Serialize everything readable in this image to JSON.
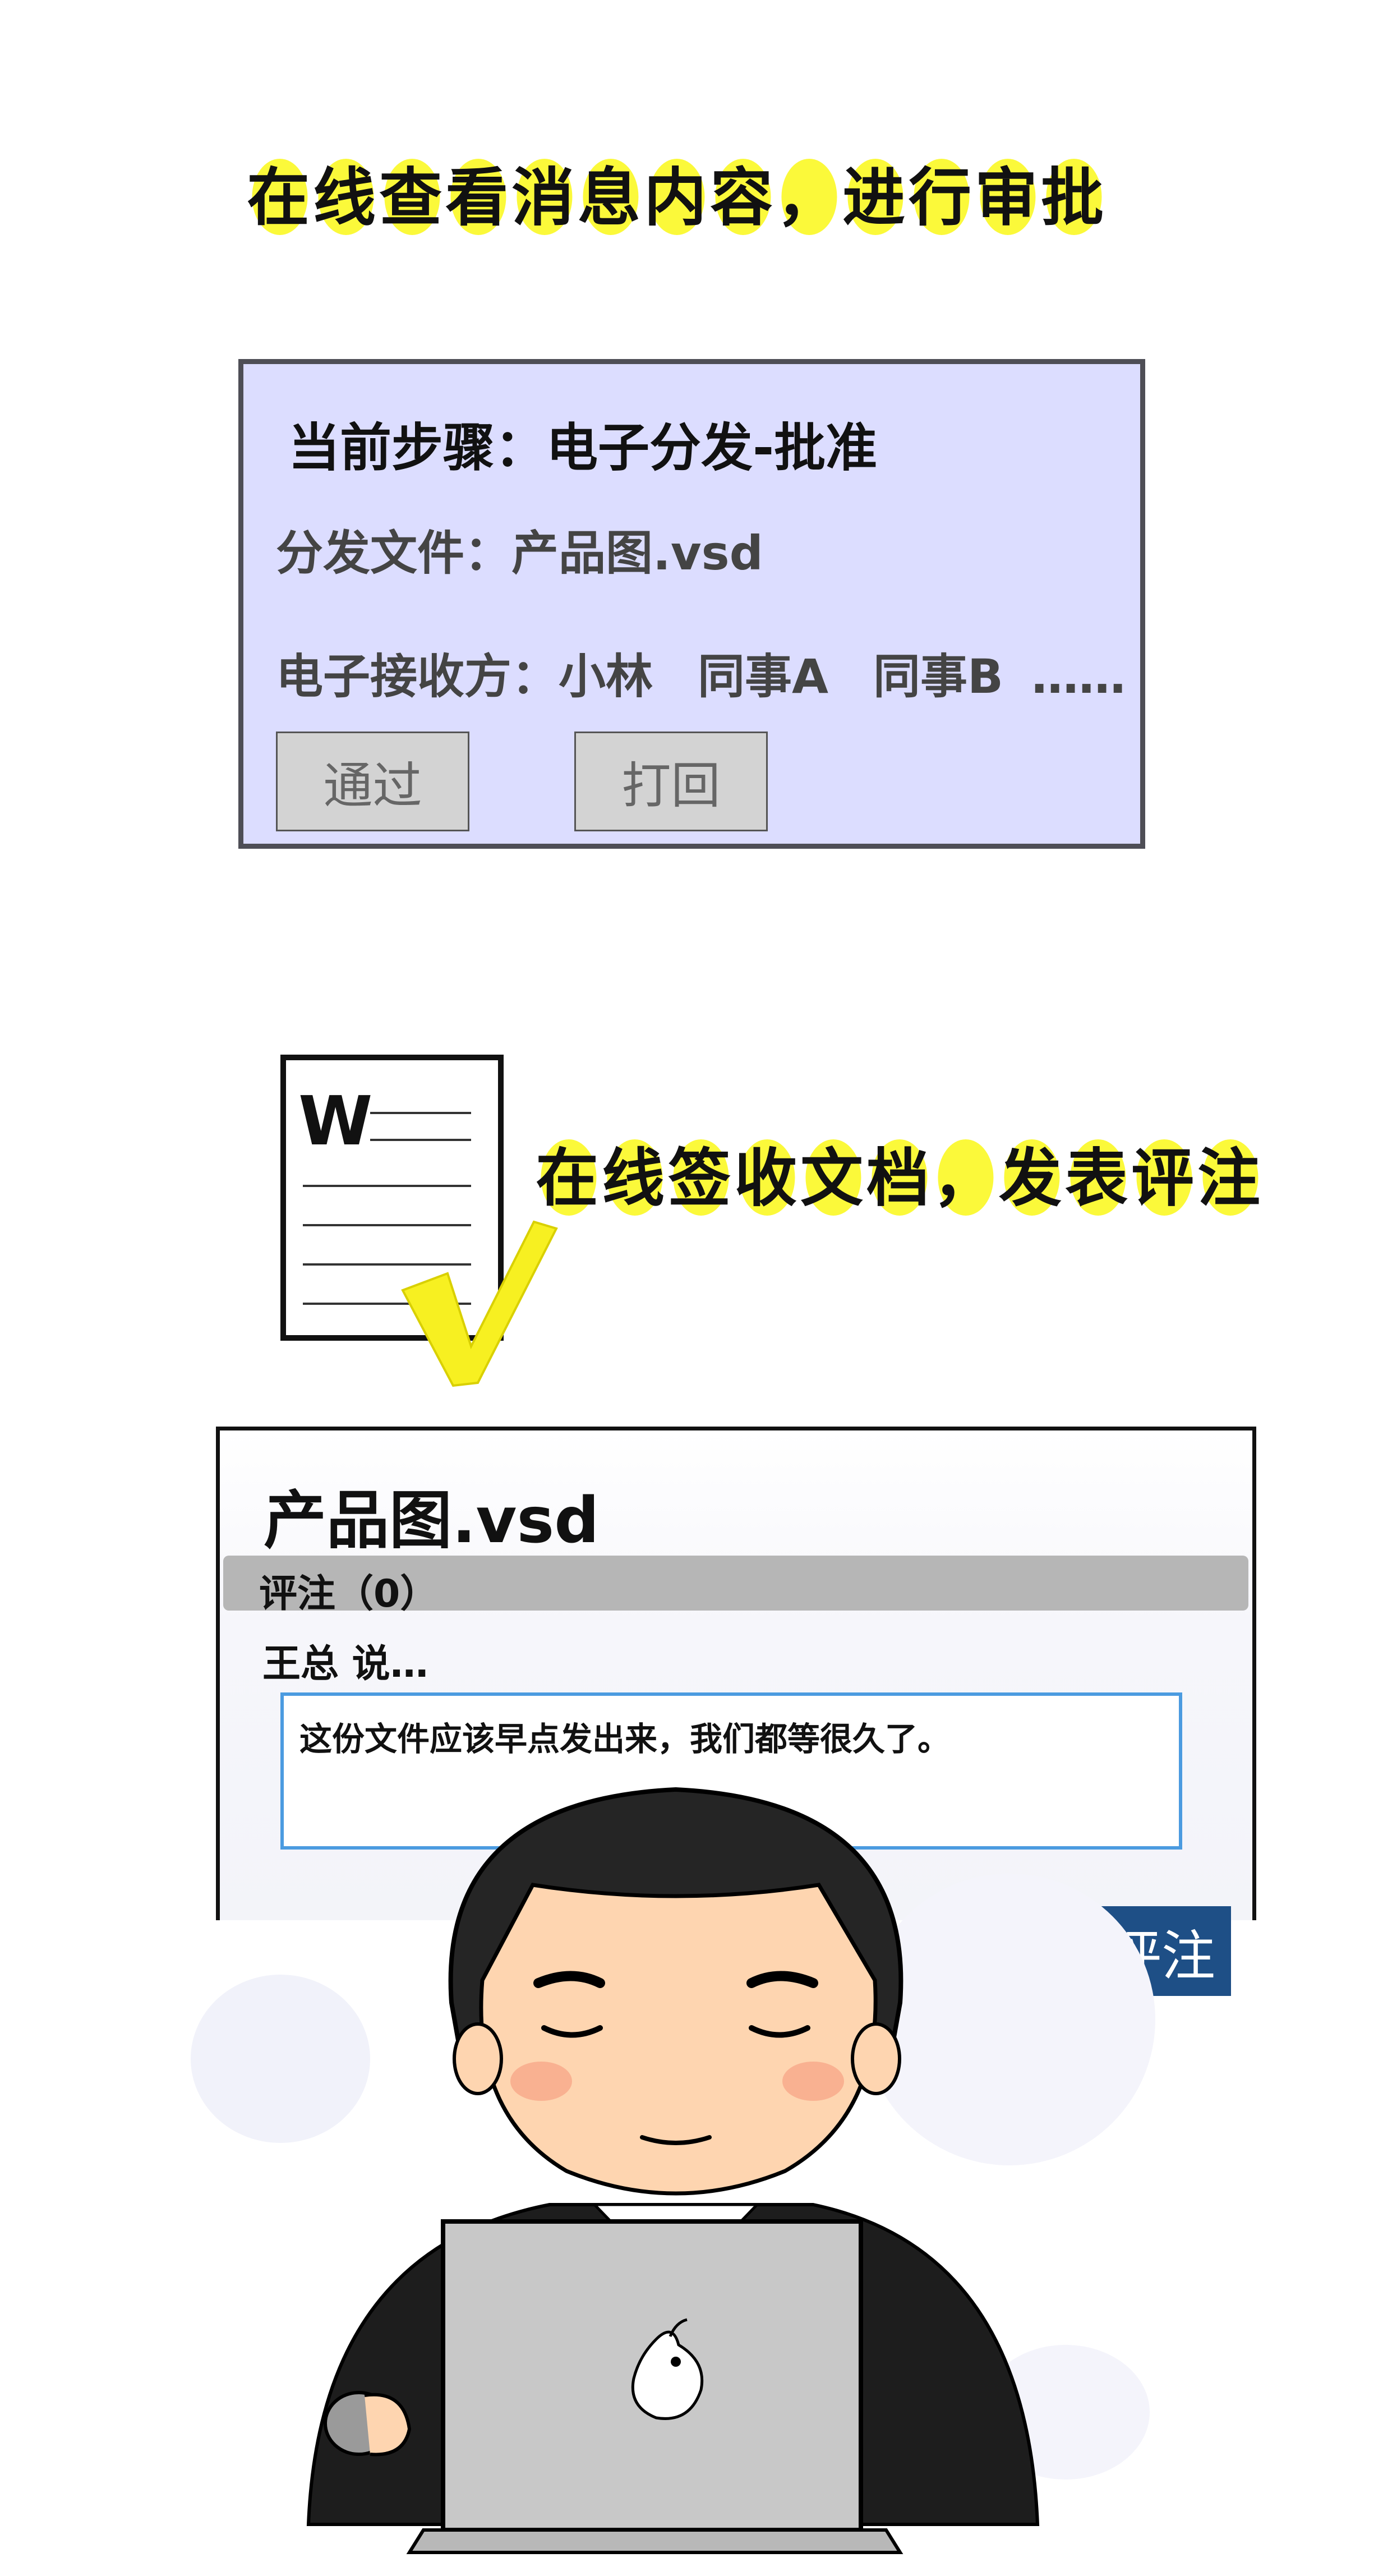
{
  "headings": {
    "approve": [
      "在",
      "线",
      "查",
      "看",
      "消",
      "息",
      "内",
      "容",
      "，",
      "进",
      "行",
      "审",
      "批"
    ],
    "sign": [
      "在",
      "线",
      "签",
      "收",
      "文",
      "档",
      "，",
      "发",
      "表",
      "评",
      "注"
    ]
  },
  "approval_panel": {
    "step_label": "当前步骤：电子分发-批准",
    "file_label": "分发文件：产品图.vsd",
    "recipients_prefix": "电子接收方：",
    "recipients": [
      "小林",
      "同事A",
      "同事B",
      "……"
    ],
    "pass_button": "通过",
    "reject_button": "打回"
  },
  "document_icon": {
    "letter": "W",
    "check_color": "#f7f021"
  },
  "comment_panel": {
    "title": "产品图.vsd",
    "comments_header": "评注（0）",
    "author_line": "王总 说…",
    "comment_text": "这份文件应该早点发出来，我们都等很久了。",
    "publish_button": "发表评注"
  },
  "colors": {
    "highlight": "#fbf93a",
    "panel_bg": "#dcddff",
    "publish_bg": "#1e4f86",
    "comment_border": "#4b9be0"
  }
}
